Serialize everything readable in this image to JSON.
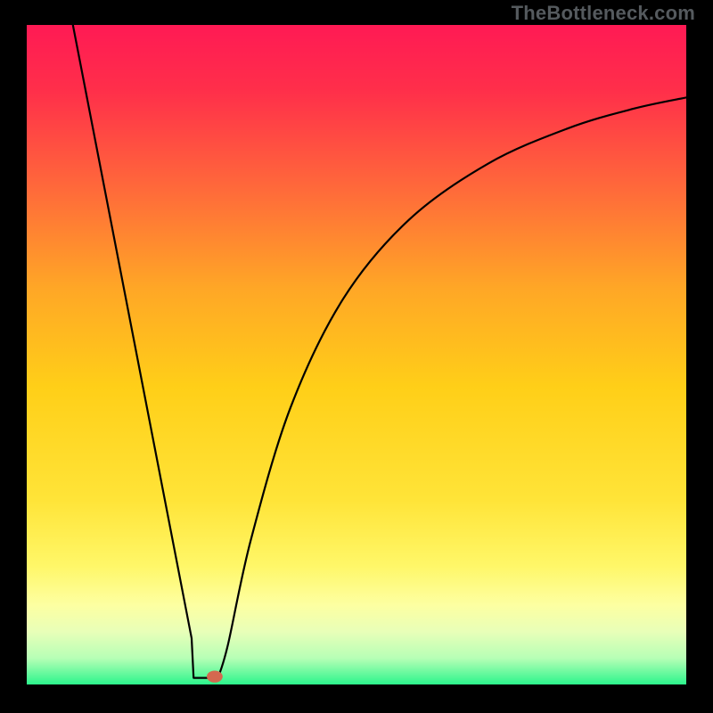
{
  "watermark": "TheBottleneck.com",
  "frame": {
    "outer_bg": "#000000",
    "inner_left": 30,
    "inner_top": 28,
    "inner_size": 740
  },
  "chart_data": {
    "type": "line",
    "title": "",
    "xlabel": "",
    "ylabel": "",
    "xlim": [
      0,
      100
    ],
    "ylim": [
      0,
      100
    ],
    "gradient_stops": [
      {
        "offset": 0.0,
        "color": "#ff1a54"
      },
      {
        "offset": 0.1,
        "color": "#ff2f4a"
      },
      {
        "offset": 0.25,
        "color": "#ff6a3a"
      },
      {
        "offset": 0.4,
        "color": "#ffa726"
      },
      {
        "offset": 0.55,
        "color": "#ffcf18"
      },
      {
        "offset": 0.72,
        "color": "#ffe438"
      },
      {
        "offset": 0.82,
        "color": "#fff768"
      },
      {
        "offset": 0.88,
        "color": "#fdffa2"
      },
      {
        "offset": 0.92,
        "color": "#e8ffb8"
      },
      {
        "offset": 0.96,
        "color": "#b7ffb6"
      },
      {
        "offset": 1.0,
        "color": "#2cf58c"
      }
    ],
    "curve": {
      "left_branch": [
        {
          "x": 7.0,
          "y": 100.0
        },
        {
          "x": 25.0,
          "y": 7.0
        },
        {
          "x": 25.3,
          "y": 1.0
        }
      ],
      "bottom_segment": [
        {
          "x": 25.3,
          "y": 1.0
        },
        {
          "x": 29.0,
          "y": 1.0
        }
      ],
      "right_branch": [
        {
          "x": 29.0,
          "y": 1.0
        },
        {
          "x": 30.5,
          "y": 6.0
        },
        {
          "x": 34.0,
          "y": 22.0
        },
        {
          "x": 40.0,
          "y": 42.0
        },
        {
          "x": 48.0,
          "y": 58.5
        },
        {
          "x": 58.0,
          "y": 70.5
        },
        {
          "x": 70.0,
          "y": 79.0
        },
        {
          "x": 82.0,
          "y": 84.3
        },
        {
          "x": 92.0,
          "y": 87.3
        },
        {
          "x": 100.0,
          "y": 89.0
        }
      ]
    },
    "marker": {
      "x": 28.5,
      "y": 1.2,
      "rx": 1.2,
      "ry": 0.9,
      "color": "#d4684f"
    },
    "stroke": {
      "color": "#000000",
      "width": 2.2
    }
  }
}
